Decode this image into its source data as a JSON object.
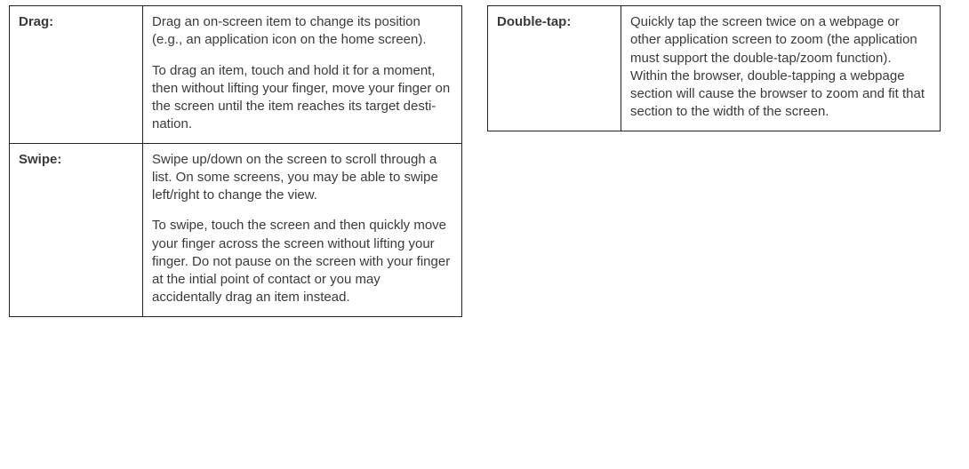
{
  "left": {
    "rows": [
      {
        "term": "Drag:",
        "paras": [
          "Drag an on-screen item to change its position (e.g., an application icon on the home screen).",
          "To drag an item, touch and hold it for a moment, then without lifting your finger, move your finger on the screen until the item reaches its target desti­nation."
        ]
      },
      {
        "term": "Swipe:",
        "paras": [
          "Swipe up/down on the screen to scroll through a list. On some screens, you may be able to swipe left/right to change the view.",
          "To swipe, touch the screen and then quickly move your finger across the screen without lifting your finger. Do not pause on the screen with your finger at the intial point of contact or you may accidentally drag an item instead."
        ]
      }
    ]
  },
  "right": {
    "rows": [
      {
        "term": "Double-tap:",
        "paras": [
          "Quickly tap the screen twice on a webpage or other application screen to zoom (the application must support the double-tap/zoom function). Within the browser, double-tapping a webpage section will cause the browser to zoom and fit that section to the width of the screen."
        ]
      }
    ]
  }
}
